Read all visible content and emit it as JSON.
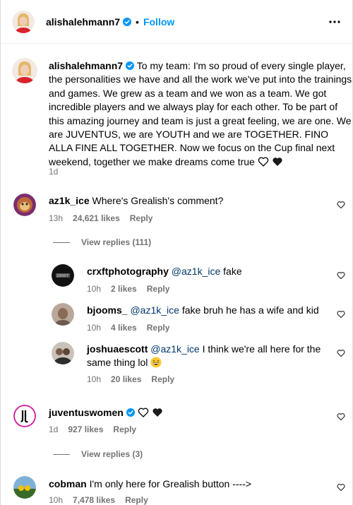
{
  "post_header": {
    "username": "alishalehmann7",
    "separator": "•",
    "follow_label": "Follow"
  },
  "caption": {
    "username": "alishalehmann7",
    "text": "To my team: I'm so proud of every single player, the personalities we have and all the work we've put into the trainings and games. We grew as a team and we won as a team. We got incredible players and we always play for each other. To be part of this amazing journey and team is just a great feeling, we are one. We are JUVENTUS, we are YOUTH and we are TOGETHER. FINO ALLA FINE ALL TOGETHER. Now we focus on the Cup final next weekend, together we make dreams come true",
    "time": "1d"
  },
  "comments": [
    {
      "username": "az1k_ice",
      "text": "Where's Grealish's comment?",
      "time": "13h",
      "likes": "24,621 likes",
      "reply_label": "Reply",
      "view_replies": "View replies (111)",
      "replies": [
        {
          "username": "crxftphotography",
          "mention": "@az1k_ice",
          "text": "fake",
          "time": "10h",
          "likes": "2 likes",
          "reply_label": "Reply"
        },
        {
          "username": "bjooms_",
          "mention": "@az1k_ice",
          "text": "fake bruh he has a wife and kid",
          "time": "10h",
          "likes": "4 likes",
          "reply_label": "Reply"
        },
        {
          "username": "joshuaescott",
          "mention": "@az1k_ice",
          "text_line1": "I think we're all here for the",
          "text_line2": "same thing lol",
          "time": "10h",
          "likes": "20 likes",
          "reply_label": "Reply"
        }
      ]
    },
    {
      "username": "juventuswomen",
      "time": "1d",
      "likes": "927 likes",
      "reply_label": "Reply",
      "view_replies": "View replies (3)"
    },
    {
      "username": "cobman",
      "text": "I'm only here for Grealish button ---->",
      "time": "10h",
      "likes": "7,478 likes",
      "reply_label": "Reply"
    }
  ],
  "colors": {
    "link_blue": "#0095f6",
    "mention_blue": "#00376b",
    "meta_gray": "#737373",
    "verified_blue": "#0095f6"
  }
}
